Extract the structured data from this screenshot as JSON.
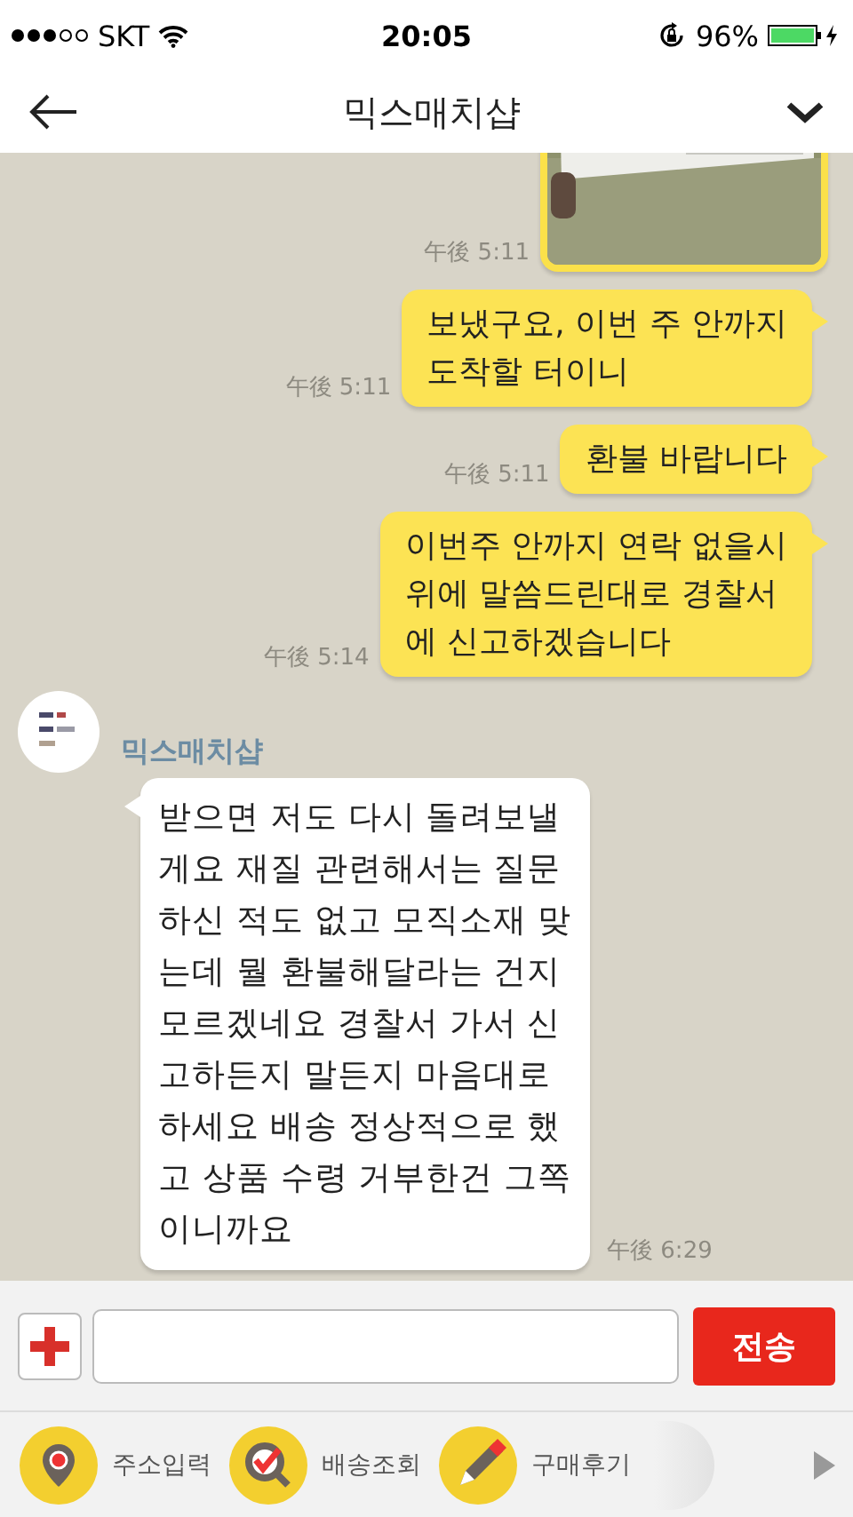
{
  "status_bar": {
    "carrier": "SKT",
    "time": "20:05",
    "battery": "96%"
  },
  "header": {
    "title": "믹스매치샵"
  },
  "messages": [
    {
      "outgoing": true,
      "time": "午後 5:11"
    },
    {
      "kind": "text",
      "outgoing": true,
      "text": "보냈구요, 이번 주 안까지\n도착할 터이니",
      "time": "午後 5:11"
    },
    {
      "kind": "text",
      "outgoing": true,
      "text": "환불 바랍니다",
      "time": "午後 5:11"
    },
    {
      "kind": "text",
      "outgoing": true,
      "text": "이번주 안까지 연락 없을시\n위에 말씀드린대로 경찰서\n에 신고하겠습니다",
      "time": "午後 5:14"
    },
    {
      "kind": "text",
      "outgoing": false,
      "sender": "믹스매치샵",
      "text": "받으면 저도 다시 돌려보낼\n게요 재질 관련해서는 질문\n하신 적도 없고 모직소재 맞\n는데 뭘 환불해달라는 건지\n모르겠네요 경찰서 가서 신\n고하든지 말든지 마음대로\n하세요 배송 정상적으로 했\n고 상품 수령 거부한건 그쪽\n이니까요",
      "time": "午後 6:29"
    }
  ],
  "composer": {
    "send_label": "전송"
  },
  "quick_menu": [
    {
      "kind": "address",
      "label": "주소입력"
    },
    {
      "kind": "tracking",
      "label": "배송조회"
    },
    {
      "kind": "review",
      "label": "구매후기"
    }
  ]
}
